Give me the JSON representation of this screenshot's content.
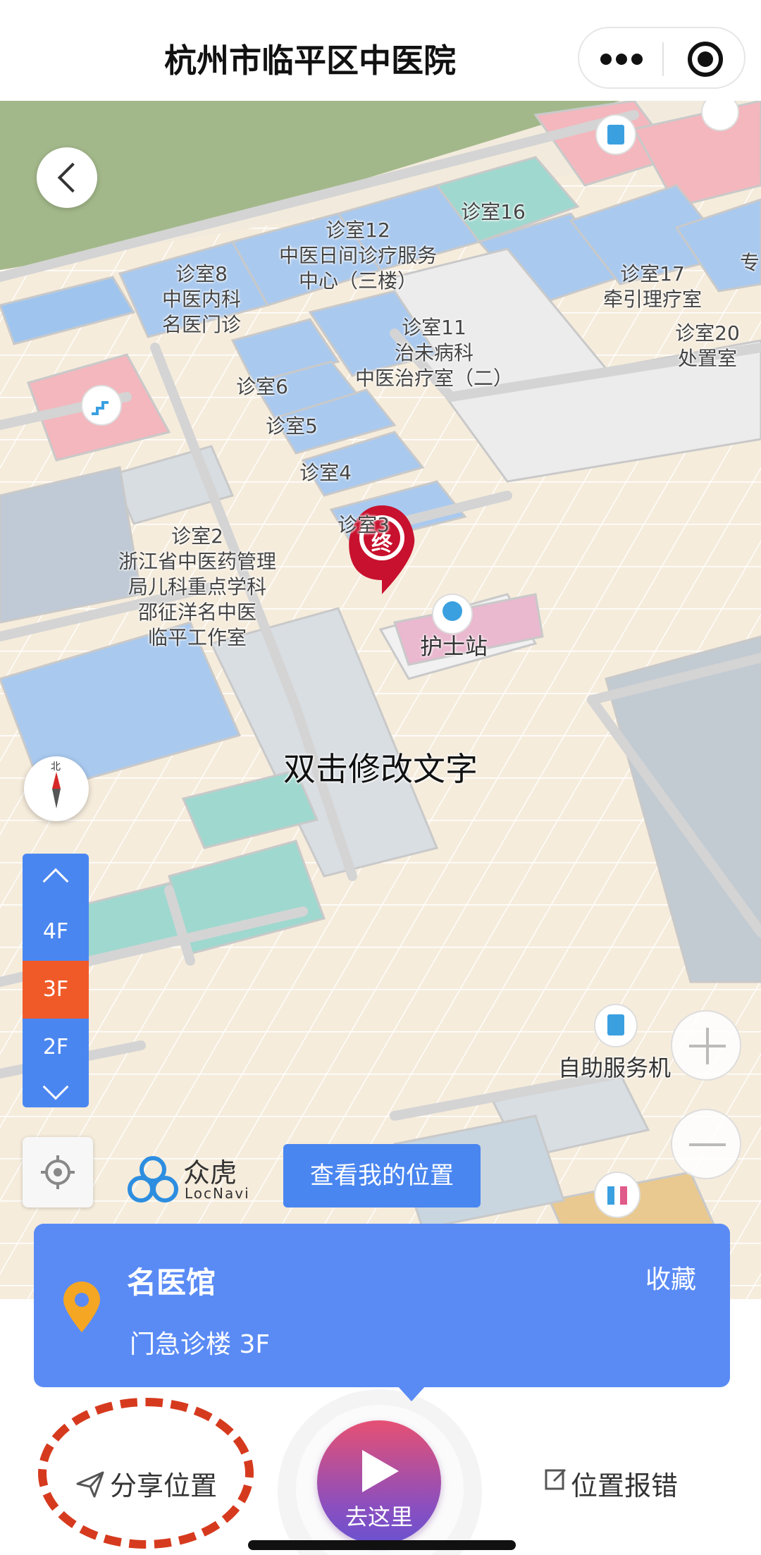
{
  "header": {
    "title": "杭州市临平区中医院"
  },
  "map": {
    "rooms": [
      {
        "text": "诊室16"
      },
      {
        "text": "诊室12\n中医日间诊疗服务\n中心（三楼）"
      },
      {
        "text": "诊室8\n中医内科\n名医门诊"
      },
      {
        "text": "诊室17\n牵引理疗室"
      },
      {
        "text": "专"
      },
      {
        "text": "诊室20\n处置室"
      },
      {
        "text": "诊室11\n治未病科\n中医治疗室（二）"
      },
      {
        "text": "诊室6"
      },
      {
        "text": "诊室5"
      },
      {
        "text": "诊室4"
      },
      {
        "text": "诊室3"
      },
      {
        "text": "诊室2\n浙江省中医药管理\n局儿科重点学科\n邵征洋名中医\n临平工作室"
      }
    ],
    "nurse_station": "护士站",
    "edit_hint": "双击修改文字",
    "self_service": "自助服务机",
    "destination_marker": "终",
    "compass_north": "北"
  },
  "floor_switcher": {
    "floors": [
      "4F",
      "3F",
      "2F"
    ],
    "current": "3F"
  },
  "brand": {
    "name": "众虎",
    "sub": "LocNavi"
  },
  "my_location_button": "查看我的位置",
  "card": {
    "name": "名医馆",
    "favorite": "收藏",
    "floor": "门急诊楼 3F"
  },
  "bottom": {
    "share": "分享位置",
    "go": "去这里",
    "report": "位置报错"
  },
  "colors": {
    "accent": "#5a8bf5",
    "floor_current": "#f05a28",
    "highlight_ring": "#d63a1e"
  }
}
